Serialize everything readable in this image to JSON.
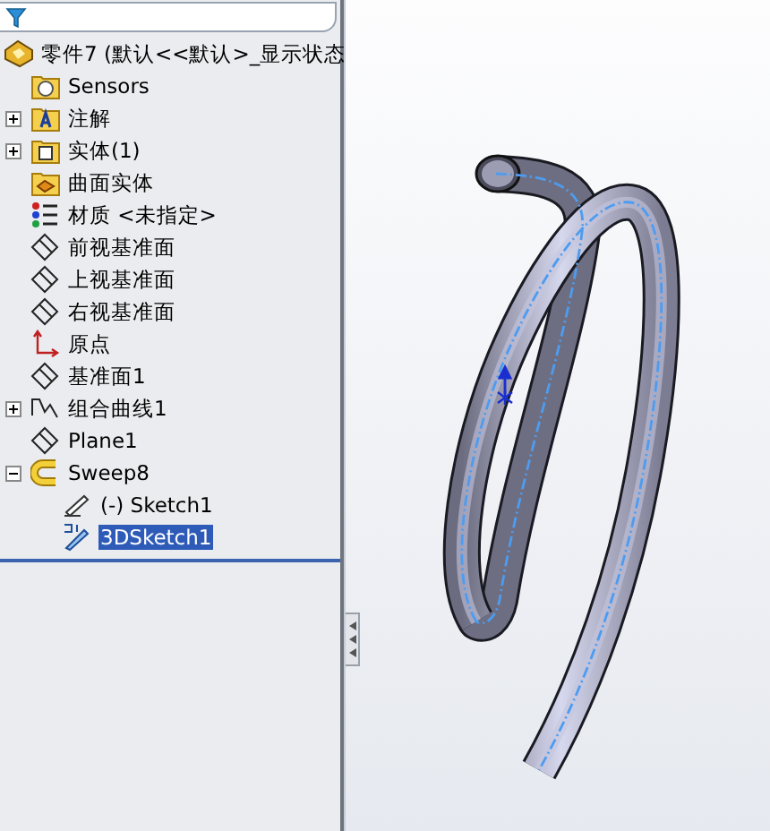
{
  "feature_tree": {
    "root": {
      "label": "零件7   (默认<<默认>_显示状态",
      "kind": "part",
      "selected": false,
      "children": [
        {
          "label": "Sensors",
          "kind": "sensors",
          "selected": false
        },
        {
          "label": "注解",
          "kind": "annotations",
          "expanded": false,
          "selected": false
        },
        {
          "label": "实体(1)",
          "kind": "solids",
          "expanded": false,
          "selected": false
        },
        {
          "label": "曲面实体",
          "kind": "surfaces",
          "selected": false
        },
        {
          "label": "材质 <未指定>",
          "kind": "material",
          "selected": false
        },
        {
          "label": "前视基准面",
          "kind": "plane",
          "selected": false
        },
        {
          "label": "上视基准面",
          "kind": "plane",
          "selected": false
        },
        {
          "label": "右视基准面",
          "kind": "plane",
          "selected": false
        },
        {
          "label": "原点",
          "kind": "origin",
          "selected": false
        },
        {
          "label": "基准面1",
          "kind": "plane",
          "selected": false
        },
        {
          "label": "组合曲线1",
          "kind": "curve",
          "expanded": false,
          "selected": false
        },
        {
          "label": "Plane1",
          "kind": "plane",
          "selected": false
        },
        {
          "label": "Sweep8",
          "kind": "sweep",
          "expanded": true,
          "selected": false,
          "children": [
            {
              "label": "(-) Sketch1",
              "kind": "sketch",
              "selected": false
            },
            {
              "label": "3DSketch1",
              "kind": "sketch3d",
              "selected": true
            }
          ]
        }
      ]
    }
  }
}
